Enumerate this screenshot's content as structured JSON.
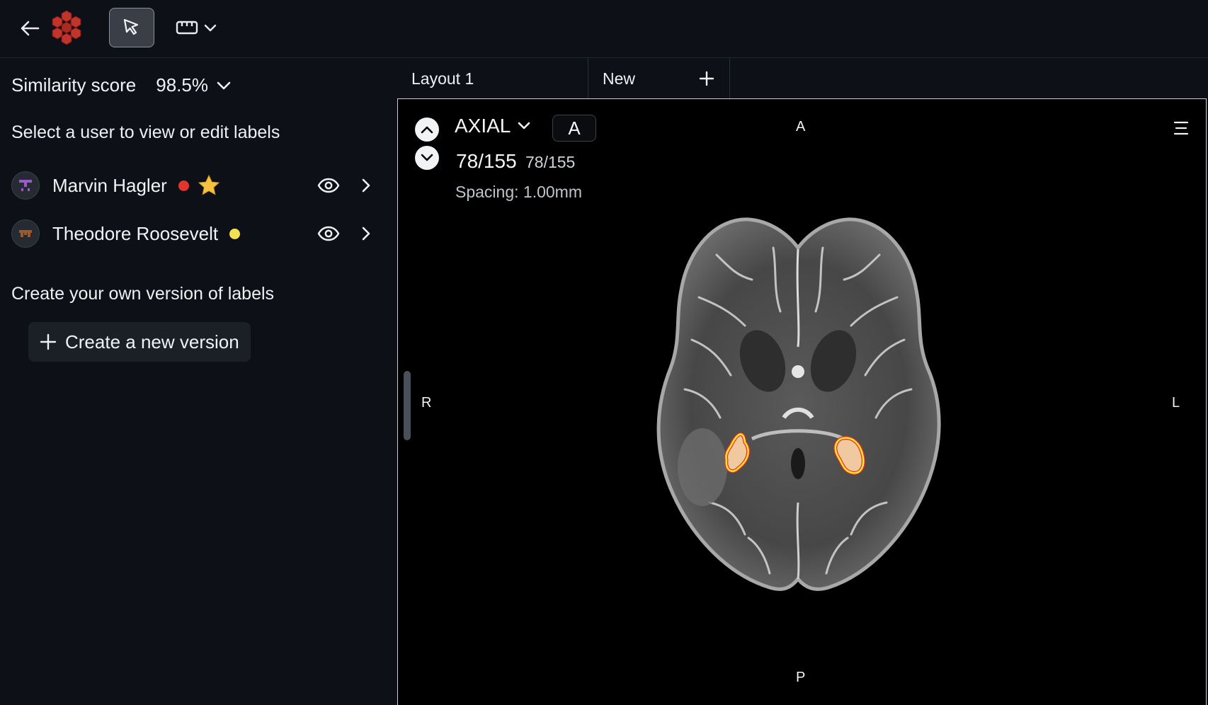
{
  "toolbar": {
    "back_icon": "arrow-left-icon",
    "logo": "cube-cluster-logo",
    "pointer_tool_icon": "cursor-arrow-icon",
    "ruler_tool_icon": "ruler-icon"
  },
  "sidebar": {
    "similarity_label": "Similarity score",
    "similarity_value": "98.5%",
    "users_heading": "Select a user to view or edit labels",
    "users": [
      {
        "name": "Marvin Hagler",
        "status_color": "#e5342a",
        "starred": true
      },
      {
        "name": "Theodore Roosevelt",
        "status_color": "#f5e050",
        "starred": false
      }
    ],
    "create_heading": "Create your own version of labels",
    "create_button": "Create a new version"
  },
  "tabs": [
    {
      "label": "Layout 1"
    },
    {
      "label": "New"
    }
  ],
  "viewer": {
    "plane": "AXIAL",
    "orientation_button": "A",
    "slice_main": "78/155",
    "slice_sub": "78/155",
    "spacing": "Spacing: 1.00mm",
    "orientation": {
      "top": "A",
      "bottom": "P",
      "left": "R",
      "right": "L"
    },
    "overlay_colors": {
      "fill": "#f1c9a0",
      "outline_outer": "#e8301c",
      "outline_inner": "#ffe536"
    }
  }
}
